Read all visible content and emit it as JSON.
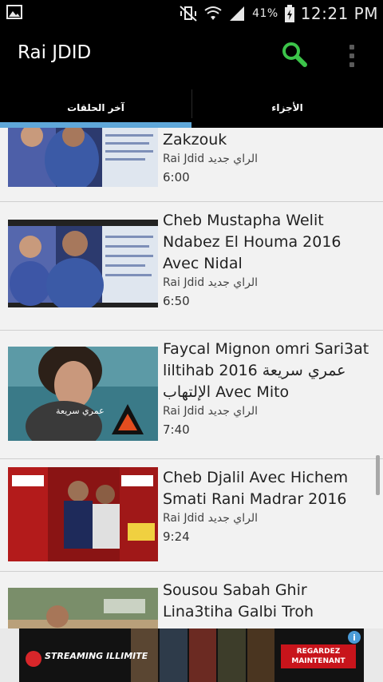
{
  "status_bar": {
    "battery_percent": "41%",
    "time": "12:21 PM"
  },
  "app": {
    "title": "Rai JDID"
  },
  "tabs": [
    {
      "label": "الأجزاء",
      "active": false
    },
    {
      "label": "آخر الحلقات",
      "active": true
    }
  ],
  "videos": [
    {
      "title": "Zakzouk",
      "channel": "Rai Jdid الراي جديد",
      "duration": "6:00"
    },
    {
      "title": "Cheb Mustapha Welit Ndabez El Houma 2016 Avec Nidal",
      "channel": "Rai Jdid الراي جديد",
      "duration": "6:50"
    },
    {
      "title": "Faycal Mignon omri Sari3at liltihab 2016 عمري سريعة الإلتهاب Avec Mito",
      "channel": "Rai Jdid الراي جديد",
      "duration": "7:40"
    },
    {
      "title": "Cheb Djalil Avec Hichem Smati Rani Madrar 2016",
      "channel": "Rai Jdid الراي جديد",
      "duration": "9:24"
    },
    {
      "title": "Sousou Sabah Ghir Lina3tiha Galbi Troh",
      "channel": "",
      "duration": ""
    }
  ],
  "ad": {
    "brand": "STREAMING ILLIMITE",
    "cta": "REGARDEZ MAINTENANT",
    "info_icon": "i"
  },
  "colors": {
    "accent": "#5fa7d9",
    "bar_bg": "#000000",
    "list_bg": "#f2f2f2",
    "search_green": "#3cc44a"
  }
}
